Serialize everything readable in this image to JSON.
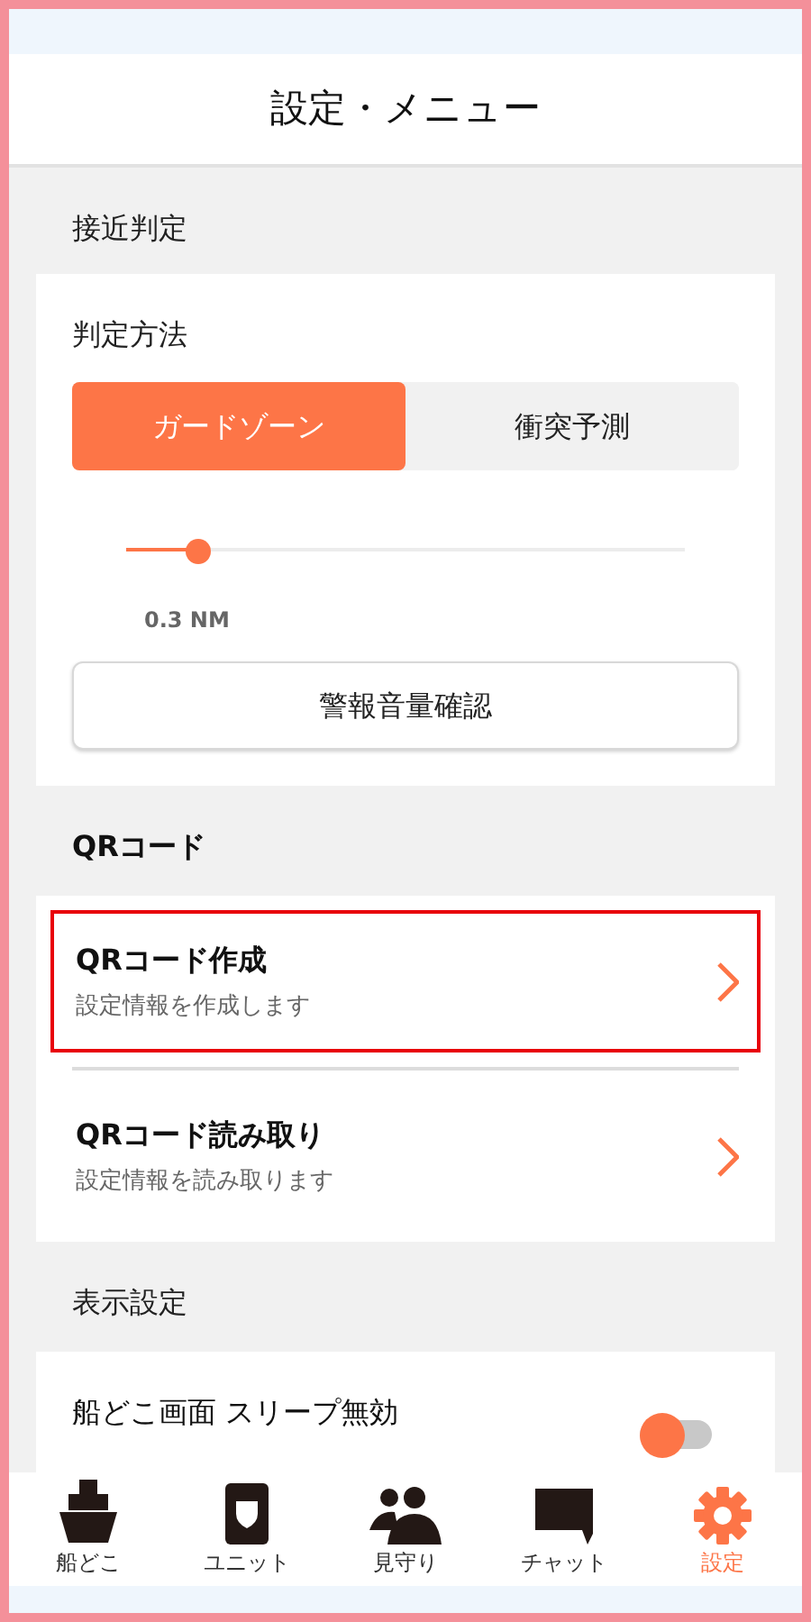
{
  "header": {
    "title": "設定・メニュー"
  },
  "proximity": {
    "section_label": "接近判定",
    "method_label": "判定方法",
    "methods": [
      {
        "label": "ガードゾーン",
        "selected": true
      },
      {
        "label": "衝突予測",
        "selected": false
      }
    ],
    "range": {
      "level": 0.13,
      "reading": "0.3 NM"
    },
    "alarm_button": "警報音量確認"
  },
  "qr": {
    "section_label": "QRコード",
    "items": [
      {
        "title": "QRコード作成",
        "subtitle": "設定情報を作成します",
        "highlighted": true
      },
      {
        "title": "QRコード読み取り",
        "subtitle": "設定情報を読み取ります",
        "highlighted": false
      }
    ]
  },
  "display": {
    "section_label": "表示設定",
    "items": [
      {
        "title": "船どこ画面 スリープ無効",
        "on": false
      }
    ]
  },
  "tab_bar": [
    {
      "kind": "ship",
      "label": "船どこ",
      "selected": false
    },
    {
      "kind": "unit",
      "label": "ユニット",
      "selected": false
    },
    {
      "kind": "people",
      "label": "見守り",
      "selected": false
    },
    {
      "kind": "chat",
      "label": "チャット",
      "selected": false
    },
    {
      "kind": "gear",
      "label": "設定",
      "selected": true
    }
  ]
}
